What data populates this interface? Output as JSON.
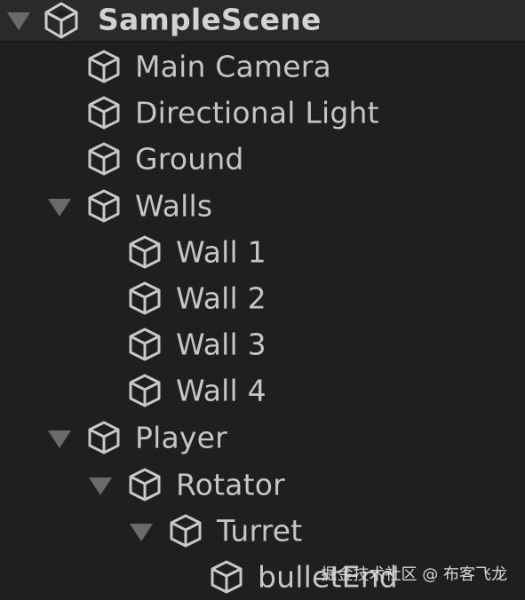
{
  "hierarchy": {
    "scene_name": "SampleScene",
    "items": [
      {
        "label": "Main Camera"
      },
      {
        "label": "Directional Light"
      },
      {
        "label": "Ground"
      },
      {
        "label": "Walls"
      },
      {
        "label": "Wall 1"
      },
      {
        "label": "Wall 2"
      },
      {
        "label": "Wall 3"
      },
      {
        "label": "Wall 4"
      },
      {
        "label": "Player"
      },
      {
        "label": "Rotator"
      },
      {
        "label": "Turret"
      },
      {
        "label": "bulletEnd"
      }
    ]
  },
  "watermark": "掘金技术社区 @ 布客飞龙",
  "colors": {
    "background": "#1f1f1f",
    "header_background": "#2a2a2a",
    "text": "#c6c6c6",
    "arrow": "#6a6a6a"
  },
  "icons": {
    "scene": "unity-logo-icon",
    "gameobject": "cube-icon",
    "expanded": "triangle-down-icon"
  }
}
